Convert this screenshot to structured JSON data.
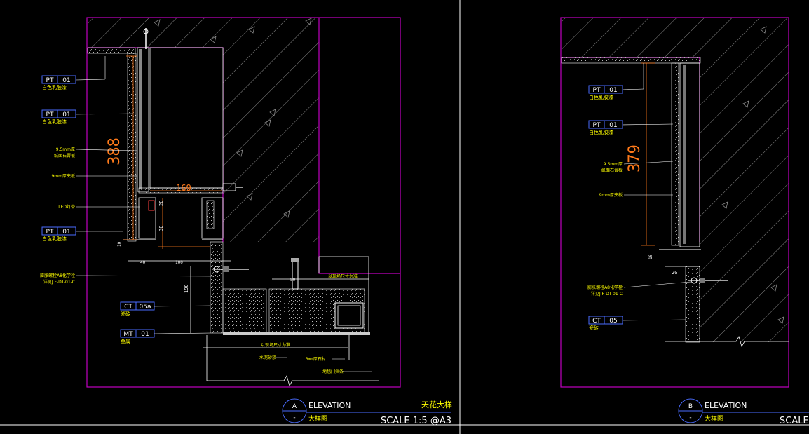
{
  "colors": {
    "background": "#000000",
    "frame": "#c000c0",
    "hatch": "#8a8a8a",
    "leader": "#ffffff",
    "label": "#ffff00",
    "tag": "#4a6cff",
    "dimension": "#ff7a1a",
    "title": "#ffffff"
  },
  "panel_a": {
    "callouts": [
      {
        "code": "PT",
        "num": "01",
        "desc": "白色乳胶漆"
      },
      {
        "code": "PT",
        "num": "01",
        "desc": "白色乳胶漆"
      },
      {
        "code": "PT",
        "num": "01",
        "desc": "白色乳胶漆"
      },
      {
        "code": "CT",
        "num": "05a",
        "desc": "瓷砖"
      },
      {
        "code": "MT",
        "num": "01",
        "desc": "金属"
      }
    ],
    "notes": [
      {
        "line1": "9.5mm厚",
        "line2": "纸面石膏板"
      },
      {
        "line1": "9mm厚夹板",
        "line2": ""
      },
      {
        "line1": "LED灯带",
        "line2": ""
      },
      {
        "line1": "膨胀螺栓A8化学栓",
        "line2": "详见J F-DT-01-C"
      }
    ],
    "dimensions": {
      "height_main": "388",
      "width_box": "169",
      "d20": "20",
      "d30": "30",
      "d10": "10",
      "d40": "40",
      "d100": "100",
      "d190": "190",
      "d50": "50"
    },
    "bottom_notes": [
      "以现场尺寸为准",
      "以现场尺寸为准",
      "水泥砂浆",
      "3mm厚石材",
      "地毯门挡条"
    ],
    "title": {
      "letter": "A",
      "sub": "-",
      "view": "ELEVATION",
      "view_cn": "大样图",
      "name_cn": "天花大样",
      "scale": "SCALE 1:5 @A3"
    }
  },
  "panel_b": {
    "callouts": [
      {
        "code": "PT",
        "num": "01",
        "desc": "白色乳胶漆"
      },
      {
        "code": "PT",
        "num": "01",
        "desc": "白色乳胶漆"
      },
      {
        "code": "CT",
        "num": "05",
        "desc": "瓷砖"
      }
    ],
    "notes": [
      {
        "line1": "9.5mm厚",
        "line2": "纸面石膏板"
      },
      {
        "line1": "9mm厚夹板",
        "line2": ""
      },
      {
        "line1": "膨胀螺栓A8化学栓",
        "line2": "详见J F-DT-01-C"
      }
    ],
    "dimensions": {
      "height_main": "379",
      "d10": "10",
      "d20": "20"
    },
    "title": {
      "letter": "B",
      "sub": "-",
      "view": "ELEVATION",
      "view_cn": "大样图",
      "scale": "SCALE"
    }
  }
}
